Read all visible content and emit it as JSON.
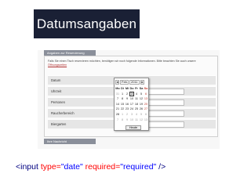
{
  "slide": {
    "title": "Datumsangaben"
  },
  "form": {
    "section_title": "Angaben zur Reservierung",
    "info_text": "Falls Sie einen Tisch reservieren möchten, benötigen wir noch folgende Informationen. Bitte beachten Sie auch unsere",
    "info_link": "Öffnungszeiten",
    "fields": [
      {
        "label": "Datum"
      },
      {
        "label": "Uhrzeit"
      },
      {
        "label": "Personen"
      },
      {
        "label": "Raucherbereich"
      },
      {
        "label": "Biergarten"
      }
    ],
    "date_value": "2011-02-0",
    "next_section_title": "Ihre Nachricht"
  },
  "datepicker": {
    "prev_label": "◂",
    "month": "Feb.",
    "year": "2011",
    "next_label": "▸",
    "weekdays": [
      "Mo",
      "Di",
      "Mi",
      "Do",
      "Fr",
      "Sa",
      "So"
    ],
    "weeks": [
      [
        "31",
        "1",
        "2",
        "3",
        "4",
        "5",
        "6"
      ],
      [
        "7",
        "8",
        "9",
        "10",
        "11",
        "12",
        "13"
      ],
      [
        "14",
        "15",
        "16",
        "17",
        "18",
        "19",
        "20"
      ],
      [
        "21",
        "22",
        "23",
        "24",
        "25",
        "26",
        "27"
      ],
      [
        "28",
        "1",
        "2",
        "3",
        "4",
        "5",
        "6"
      ],
      [
        "7",
        "8",
        "9",
        "10",
        "11",
        "12",
        "13"
      ]
    ],
    "selected_day": "3",
    "today_label": "Heute"
  },
  "code": {
    "open": "<input ",
    "attr1": "type=",
    "val1": "\"date\"",
    "attr2": " required=",
    "val2": "\"required\"",
    "close": " />"
  },
  "colors": {
    "title_bg": "#1a2035",
    "section_header": "#8a8f9a",
    "weekend": "#c0392b"
  }
}
